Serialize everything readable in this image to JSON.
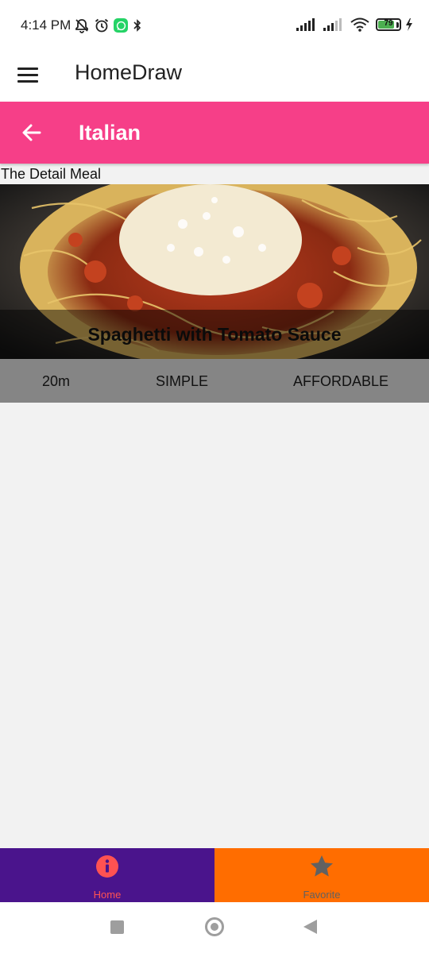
{
  "status_bar": {
    "time": "4:14 PM",
    "battery_level": 79,
    "battery_label": "79"
  },
  "app_bar": {
    "title": "HomeDraw",
    "menu_icon": "hamburger-menu-icon"
  },
  "category_bar": {
    "title": "Italian",
    "back_icon": "arrow-left-icon",
    "color": "#f63f88"
  },
  "detail": {
    "label": "The Detail Meal",
    "meal_title": "Spaghetti with Tomato Sauce",
    "duration": "20m",
    "complexity": "SIMPLE",
    "affordability": "AFFORDABLE"
  },
  "bottom_nav": {
    "tabs": [
      {
        "label": "Home",
        "icon": "info-icon",
        "background": "#4a148c",
        "color": "#ff5252"
      },
      {
        "label": "Favorite",
        "icon": "star-icon",
        "background": "#ff6d00",
        "color": "#616161"
      }
    ]
  }
}
